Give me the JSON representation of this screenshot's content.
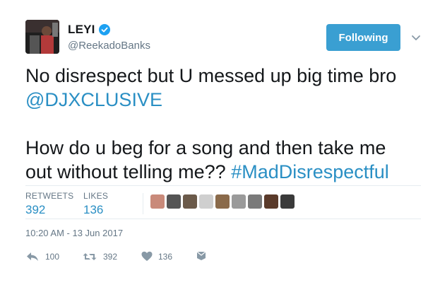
{
  "user": {
    "display_name": "LEYI",
    "handle": "@ReekadoBanks",
    "verified": true
  },
  "follow_button": {
    "label": "Following"
  },
  "tweet": {
    "line1": "No disrespect but U messed up big time bro",
    "mention": "@DJXCLUSIVE",
    "line3": "How do u beg for a song and then take me",
    "line4_text": "out without telling me?? ",
    "hashtag": "#MadDisrespectful"
  },
  "stats": {
    "retweets_label": "RETWEETS",
    "retweets_value": "392",
    "likes_label": "LIKES",
    "likes_value": "136"
  },
  "likers": [
    "#c98a7a",
    "#555555",
    "#6b5a4a",
    "#cfcfcf",
    "#8a6a4a",
    "#9a9a9a",
    "#7a7a7a",
    "#5a3a2a",
    "#3a3a3a"
  ],
  "timestamp": "10:20 AM - 13 Jun 2017",
  "actions": {
    "reply_count": "100",
    "retweet_count": "392",
    "like_count": "136"
  },
  "colors": {
    "link": "#2a8fc4",
    "follow_button": "#3a9fd2",
    "verified": "#1da1f2"
  }
}
